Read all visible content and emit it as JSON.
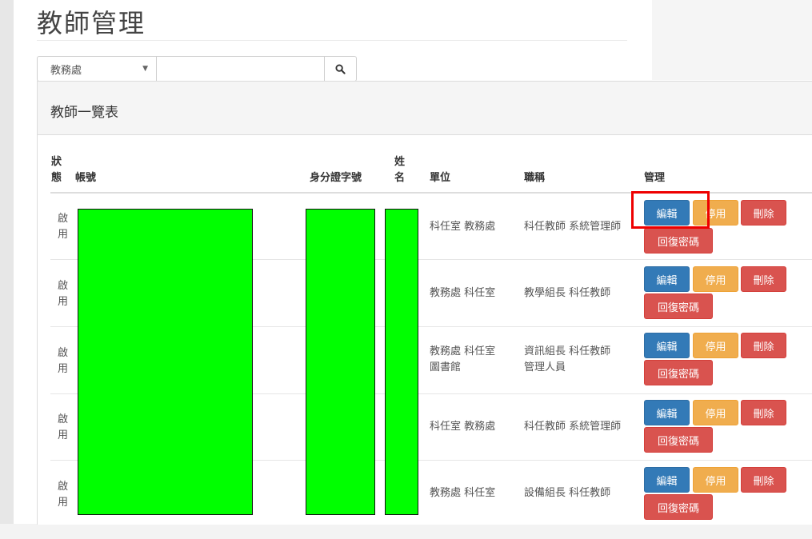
{
  "page": {
    "title": "教師管理"
  },
  "search": {
    "unit_selected": "教務處",
    "query_value": "",
    "query_placeholder": "",
    "search_icon": "search-icon"
  },
  "panel": {
    "title": "教師一覽表"
  },
  "columns": {
    "status_line1": "狀",
    "status_line2": "態",
    "account": "帳號",
    "id_number": "身分證字號",
    "name_line1": "姓",
    "name_line2": "名",
    "unit": "單位",
    "position": "職稱",
    "manage": "管理"
  },
  "actions": {
    "edit": "編輯",
    "disable": "停用",
    "delete": "刪除",
    "reset_password": "回復密碼"
  },
  "rows": [
    {
      "status_line1": "啟",
      "status_line2": "用",
      "unit_line1": "科任室 教務處",
      "unit_line2": "",
      "position_line1": "科任教師 系統管理師",
      "position_line2": ""
    },
    {
      "status_line1": "啟",
      "status_line2": "用",
      "unit_line1": "教務處 科任室",
      "unit_line2": "",
      "position_line1": "教學組長 科任教師",
      "position_line2": ""
    },
    {
      "status_line1": "啟",
      "status_line2": "用",
      "unit_line1": "教務處 科任室",
      "unit_line2": "圖書館",
      "position_line1": "資訊組長 科任教師",
      "position_line2": "管理人員"
    },
    {
      "status_line1": "啟",
      "status_line2": "用",
      "unit_line1": "科任室 教務處",
      "unit_line2": "",
      "position_line1": "科任教師 系統管理師",
      "position_line2": ""
    },
    {
      "status_line1": "啟",
      "status_line2": "用",
      "unit_line1": "教務處 科任室",
      "unit_line2": "",
      "position_line1": "設備組長 科任教師",
      "position_line2": ""
    }
  ],
  "colors": {
    "edit": "#337ab7",
    "disable": "#f0ad4e",
    "delete": "#d9534f",
    "redaction": "#00ff00",
    "highlight": "#ee0000"
  }
}
